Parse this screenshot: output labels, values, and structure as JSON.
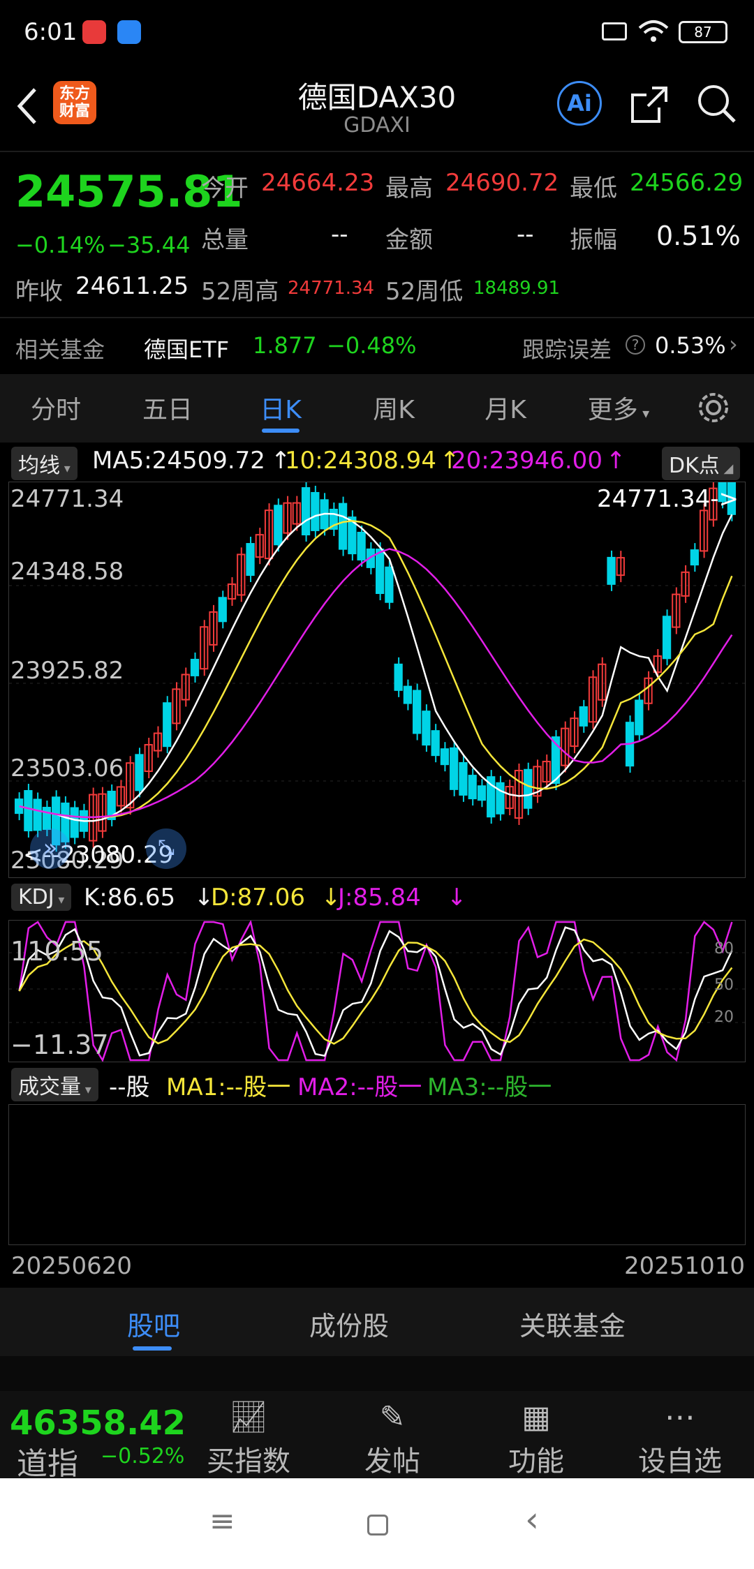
{
  "status": {
    "time": "6:01",
    "battery": "87"
  },
  "header": {
    "title": "德国DAX30",
    "subtitle": "GDAXI",
    "logo_text": "东方财富",
    "ai_label": "Ai"
  },
  "quote": {
    "price": "24575.81",
    "change_pct": "−0.14%",
    "change": "−35.44",
    "open_label": "今开",
    "open": "24664.23",
    "high_label": "最高",
    "high": "24690.72",
    "low_label": "最低",
    "low": "24566.29",
    "volume_label": "总量",
    "volume": "--",
    "amount_label": "金额",
    "amount": "--",
    "amplitude_label": "振幅",
    "amplitude": "0.51%",
    "prev_close_label": "昨收",
    "prev_close": "24611.25",
    "w52_high_label": "52周高",
    "w52_high": "24771.34",
    "w52_low_label": "52周低",
    "w52_low": "18489.91"
  },
  "fund": {
    "label": "相关基金",
    "name": "德国ETF",
    "price": "1.877",
    "change": "−0.48%",
    "tracking_label": "跟踪误差",
    "tracking": "0.53%"
  },
  "tabs": [
    "分时",
    "五日",
    "日K",
    "周K",
    "月K",
    "更多"
  ],
  "ma_legend": {
    "pill": "均线",
    "ma5": "MA5:24509.72",
    "ma10": "10:24308.94",
    "ma20": "20:23946.00",
    "dk": "DK点"
  },
  "price_axis": [
    "24771.34",
    "24348.58",
    "23925.82",
    "23503.06",
    "23080.29"
  ],
  "price_marks": {
    "high": "24771.34->",
    "low": "<--23080.29"
  },
  "kdj": {
    "pill": "KDJ",
    "k": "K:86.65",
    "d": "D:87.06",
    "j": "J:85.84",
    "top": "110.55",
    "bottom": "−11.37",
    "levels": [
      "80",
      "50",
      "20"
    ]
  },
  "volume": {
    "pill": "成交量",
    "unit": "--股",
    "ma1": "MA1:--股一",
    "ma2": "MA2:--股一",
    "ma3": "MA3:--股一"
  },
  "dates": {
    "start": "20250620",
    "end": "20251010"
  },
  "guba_tabs": [
    "股吧",
    "成份股",
    "关联基金"
  ],
  "bottom": {
    "index_price": "46358.42",
    "index_name": "道指",
    "index_change": "−0.52%",
    "buttons": [
      "买指数",
      "发帖",
      "功能",
      "设自选"
    ]
  },
  "colors": {
    "up": "#f23b3b",
    "down": "#1ed41e",
    "accent": "#3d8df7",
    "ma5": "#ffffff",
    "ma10": "#f5e63a",
    "ma20": "#e21ee8"
  }
}
